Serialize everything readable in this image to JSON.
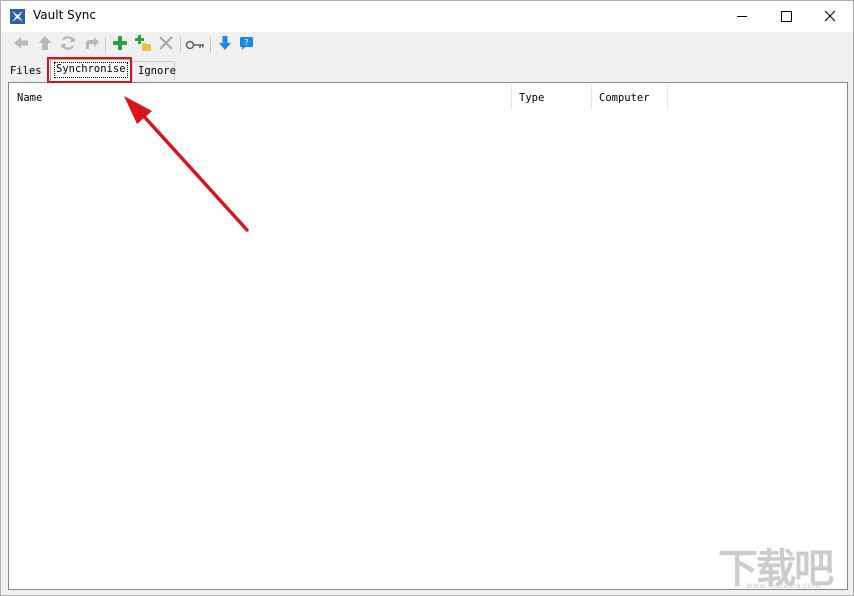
{
  "window": {
    "title": "Vault Sync",
    "controls": {
      "minimize": "minimize-icon",
      "maximize": "maximize-icon",
      "close": "close-icon"
    }
  },
  "toolbar": {
    "buttons": [
      {
        "name": "back",
        "icon": "arrow-left-icon",
        "enabled": false
      },
      {
        "name": "up",
        "icon": "arrow-up-icon",
        "enabled": false
      },
      {
        "name": "refresh",
        "icon": "refresh-icon",
        "enabled": false
      },
      {
        "name": "forward",
        "icon": "share-arrow-icon",
        "enabled": false
      },
      {
        "name": "add",
        "icon": "plus-icon",
        "enabled": true
      },
      {
        "name": "add-folder",
        "icon": "add-folder-icon",
        "enabled": true
      },
      {
        "name": "delete",
        "icon": "delete-x-icon",
        "enabled": false
      },
      {
        "name": "key",
        "icon": "key-icon",
        "enabled": true
      },
      {
        "name": "download",
        "icon": "download-arrow-icon",
        "enabled": true
      },
      {
        "name": "help",
        "icon": "help-icon",
        "enabled": true
      }
    ]
  },
  "tabs": [
    {
      "label": "Files",
      "active": false
    },
    {
      "label": "Synchronise",
      "active": true
    },
    {
      "label": "Ignore",
      "active": false
    }
  ],
  "list": {
    "columns": [
      "Name",
      "Type",
      "Computer"
    ],
    "rows": []
  },
  "annotation": {
    "highlight_color": "#d9141c",
    "arrow_color": "#d9141c"
  },
  "watermark": {
    "text": "下载吧",
    "url": "www.xiazaiba.com"
  }
}
